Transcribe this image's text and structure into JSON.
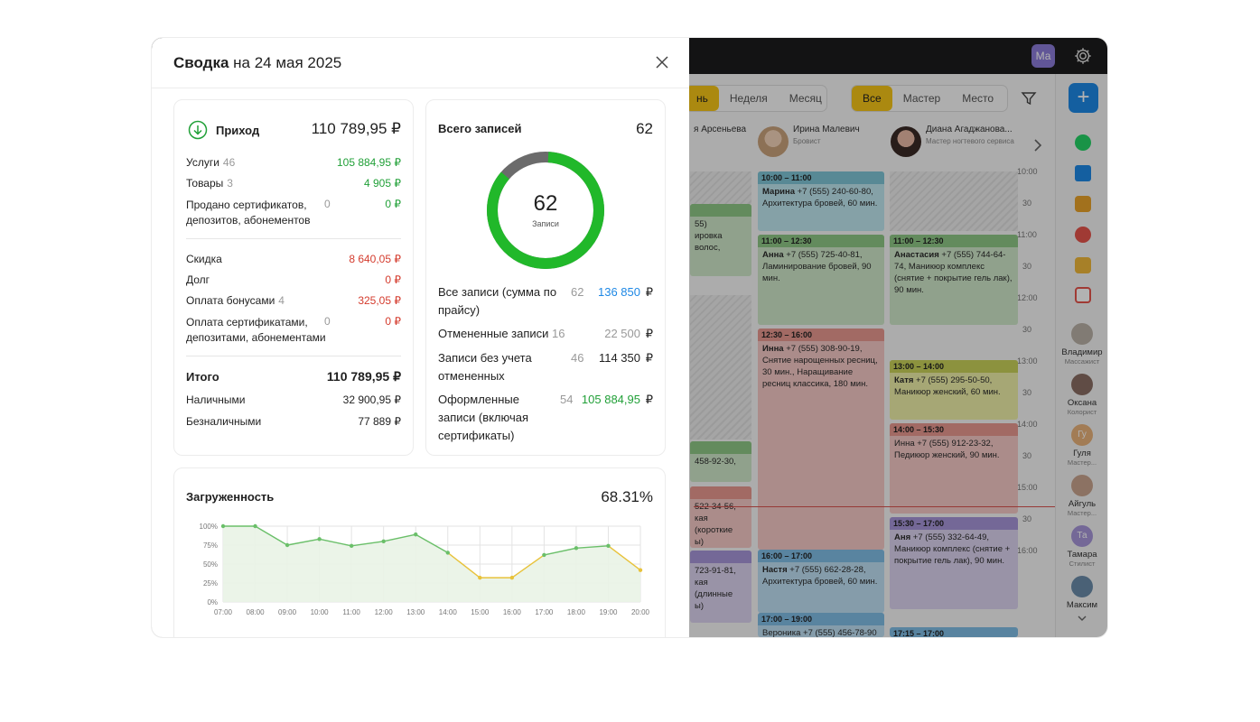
{
  "calendar": {
    "avatar_initials": "Ма",
    "view_tabs": [
      "нь",
      "Неделя",
      "Месяц"
    ],
    "filter_tabs": [
      "Все",
      "Мастер",
      "Место"
    ],
    "columns": [
      {
        "name": "я Арсеньева",
        "role": ""
      },
      {
        "name": "Ирина Малевич",
        "role": "Бровист"
      },
      {
        "name": "Диана Агаджанова...",
        "role": "Мастер ногтевого сервиса"
      }
    ],
    "times": [
      "10:00",
      "30",
      "11:00",
      "30",
      "12:00",
      "30",
      "13:00",
      "30",
      "14:00",
      "30",
      "15:00",
      "30",
      "16:00"
    ],
    "partial_texts": [
      "55)",
      "ировка волос,",
      "458-92-30,",
      "522-34-56,",
      "кая (короткие",
      "ы)",
      "723-91-81,",
      "кая (длинные",
      "ы)"
    ],
    "appointments": [
      {
        "time": "10:00 – 11:00",
        "name": "Марина",
        "text": "+7 (555) 240-60-80, Архитектура бровей, 60 мин."
      },
      {
        "time": "11:00 – 12:30",
        "name": "Анна",
        "text": "+7 (555) 725-40-81, Ламинирование бровей, 90 мин."
      },
      {
        "time": "11:00 – 12:30",
        "name": "Анастасия",
        "text": "+7 (555) 744-64-74, Маникюр комплекс (снятие + покрытие гель лак), 90 мин."
      },
      {
        "time": "12:30 – 16:00",
        "name": "Инна",
        "text": "+7 (555) 308-90-19, Снятие нарощенных ресниц, 30 мин., Наращивание ресниц классика, 180 мин."
      },
      {
        "time": "13:00 – 14:00",
        "name": "Катя",
        "text": "+7 (555) 295-50-50, Маникюр женский, 60 мин."
      },
      {
        "time": "14:00 – 15:30",
        "name": "",
        "text": "Инна +7 (555) 912-23-32, Педикюр женский, 90 мин."
      },
      {
        "time": "15:30 – 17:00",
        "name": "Аня",
        "text": "+7 (555) 332-64-49, Маникюр комплекс (снятие + покрытие гель лак), 90 мин."
      },
      {
        "time": "16:00 – 17:00",
        "name": "Настя",
        "text": "+7 (555) 662-28-28, Архитектура бровей, 60 мин."
      },
      {
        "time": "17:00 – 19:00",
        "name": "",
        "text": "Вероника +7 (555) 456-78-90"
      },
      {
        "time": "17:15 – 17:00",
        "name": "",
        "text": ""
      }
    ],
    "staff": [
      {
        "name": "Владимир",
        "role": "Массажист",
        "initials": ""
      },
      {
        "name": "Оксана",
        "role": "Колорист",
        "initials": ""
      },
      {
        "name": "Гуля",
        "role": "Мастер...",
        "initials": "Гу"
      },
      {
        "name": "Айгуль",
        "role": "Мастер...",
        "initials": ""
      },
      {
        "name": "Тамара",
        "role": "Стилист",
        "initials": "Та"
      },
      {
        "name": "Максим",
        "role": "",
        "initials": ""
      }
    ]
  },
  "modal": {
    "title_bold": "Сводка",
    "title_rest": " на 24 мая 2025",
    "income": {
      "label": "Приход",
      "total": "110 789,95 ₽",
      "rows": [
        {
          "label": "Услуги",
          "count": "46",
          "value": "105 884,95 ₽"
        },
        {
          "label": "Товары",
          "count": "3",
          "value": "4 905 ₽"
        },
        {
          "label": "Продано сертификатов,",
          "label2": "депозитов, абонементов",
          "count": "0",
          "value": "0 ₽"
        }
      ],
      "deductions": [
        {
          "label": "Скидка",
          "count": "",
          "value": "8 640,05 ₽"
        },
        {
          "label": "Долг",
          "count": "",
          "value": "0 ₽"
        },
        {
          "label": "Оплата бонусами",
          "count": "4",
          "value": "325,05 ₽"
        },
        {
          "label": "Оплата сертификатами,",
          "label2": "депозитами, абонементами",
          "count": "0",
          "value": "0 ₽"
        }
      ],
      "total_label": "Итого",
      "total_value": "110 789,95 ₽",
      "cash_label": "Наличными",
      "cash_value": "32 900,95 ₽",
      "card_label": "Безналичными",
      "card_value": "77 889 ₽"
    },
    "records": {
      "label": "Всего записей",
      "total": "62",
      "donut_value": "62",
      "donut_caption": "Записи",
      "donut_fraction": 0.871,
      "rows": [
        {
          "label": "Все записи (сумма по прайсу)",
          "count": "62",
          "value": "136 850",
          "currency": "₽"
        },
        {
          "label": "Отмененные записи",
          "count": "16",
          "value": "22 500",
          "currency": "₽"
        },
        {
          "label": "Записи без учета отмененных",
          "count": "46",
          "value": "114 350",
          "currency": "₽"
        },
        {
          "label": "Оформленные записи (включая сертификаты)",
          "count": "54",
          "value": "105 884,95",
          "currency": "₽"
        }
      ]
    },
    "load": {
      "label": "Загруженность",
      "value": "68.31%"
    }
  },
  "chart_data": {
    "type": "line",
    "title": "Загруженность",
    "x": [
      "07:00",
      "08:00",
      "09:00",
      "10:00",
      "11:00",
      "12:00",
      "13:00",
      "14:00",
      "15:00",
      "16:00",
      "17:00",
      "18:00",
      "19:00",
      "20:00"
    ],
    "y_ticks": [
      "100%",
      "75%",
      "50%",
      "25%",
      "0%"
    ],
    "ylim": [
      0,
      100
    ],
    "series": [
      {
        "values": [
          100,
          100,
          75,
          83,
          74,
          80,
          89,
          65,
          32,
          32,
          62,
          71,
          74,
          42
        ]
      }
    ],
    "colors": {
      "normal": "#6abf69",
      "low": "#e8c23a"
    },
    "grid": true
  }
}
